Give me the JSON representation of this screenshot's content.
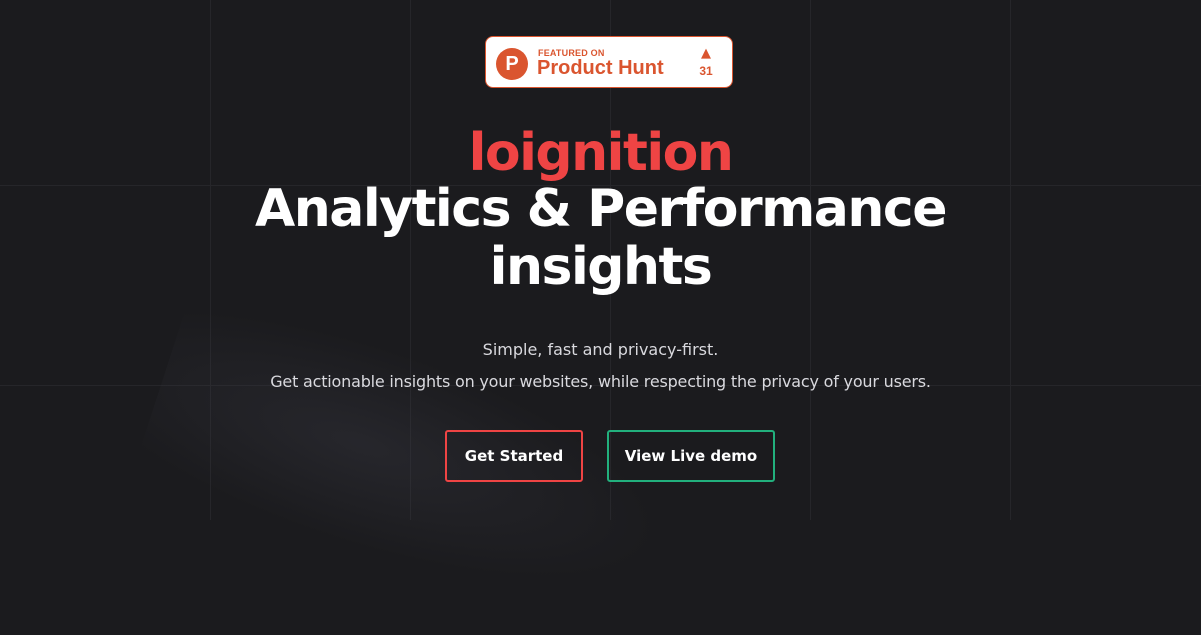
{
  "colors": {
    "background": "#1b1b1e",
    "brand": "#ef4444",
    "product_hunt": "#da552f",
    "demo_accent": "#22b07d"
  },
  "product_hunt_badge": {
    "logo_letter": "P",
    "small_label": "FEATURED ON",
    "name": "Product Hunt",
    "upvote_icon": "triangle-up-icon",
    "upvotes": "31"
  },
  "hero": {
    "brand_name": "loignition",
    "headline_line1": "Analytics & Performance",
    "headline_line2": "insights",
    "tagline": "Simple, fast and privacy-first.",
    "subtitle": "Get actionable insights on your websites, while respecting the privacy of your users."
  },
  "actions": {
    "get_started_label": "Get Started",
    "view_demo_label": "View Live demo"
  }
}
